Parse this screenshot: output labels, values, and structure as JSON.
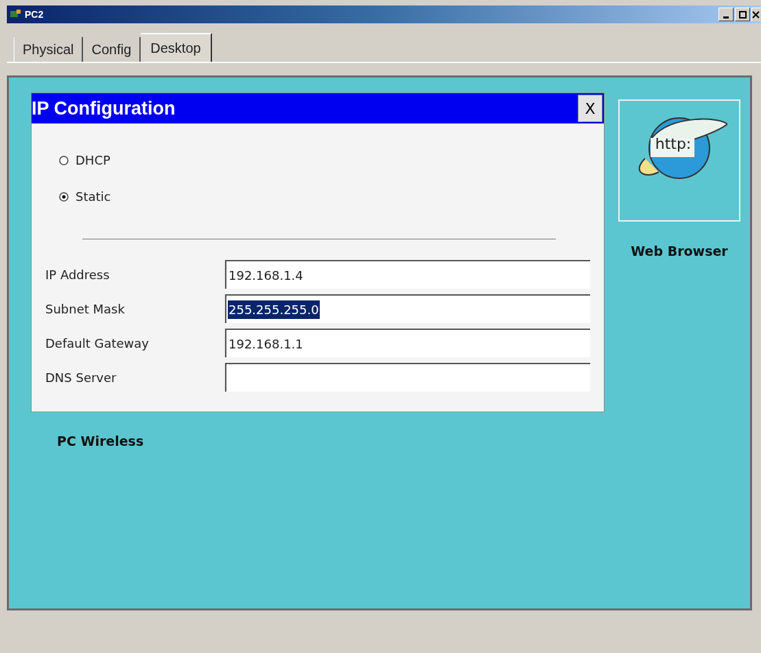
{
  "window": {
    "title": "PC2"
  },
  "tabs": [
    {
      "label": "Physical",
      "selected": false
    },
    {
      "label": "Config",
      "selected": false
    },
    {
      "label": "Desktop",
      "selected": true
    }
  ],
  "ip_configuration": {
    "title": "IP Configuration",
    "close": "X",
    "modes": [
      {
        "label": "DHCP",
        "selected": false
      },
      {
        "label": "Static",
        "selected": true
      }
    ],
    "fields": [
      {
        "label": "IP Address",
        "value": "192.168.1.4",
        "highlighted": false
      },
      {
        "label": "Subnet Mask",
        "value": "255.255.255.0",
        "highlighted": true
      },
      {
        "label": "Default Gateway",
        "value": "192.168.1.1",
        "highlighted": false
      },
      {
        "label": "DNS Server"
      }
    ]
  },
  "desktop_apps": [
    {
      "label": "Web Browser",
      "icon_text": "http:"
    },
    {
      "label": "PC Wireless"
    }
  ]
}
